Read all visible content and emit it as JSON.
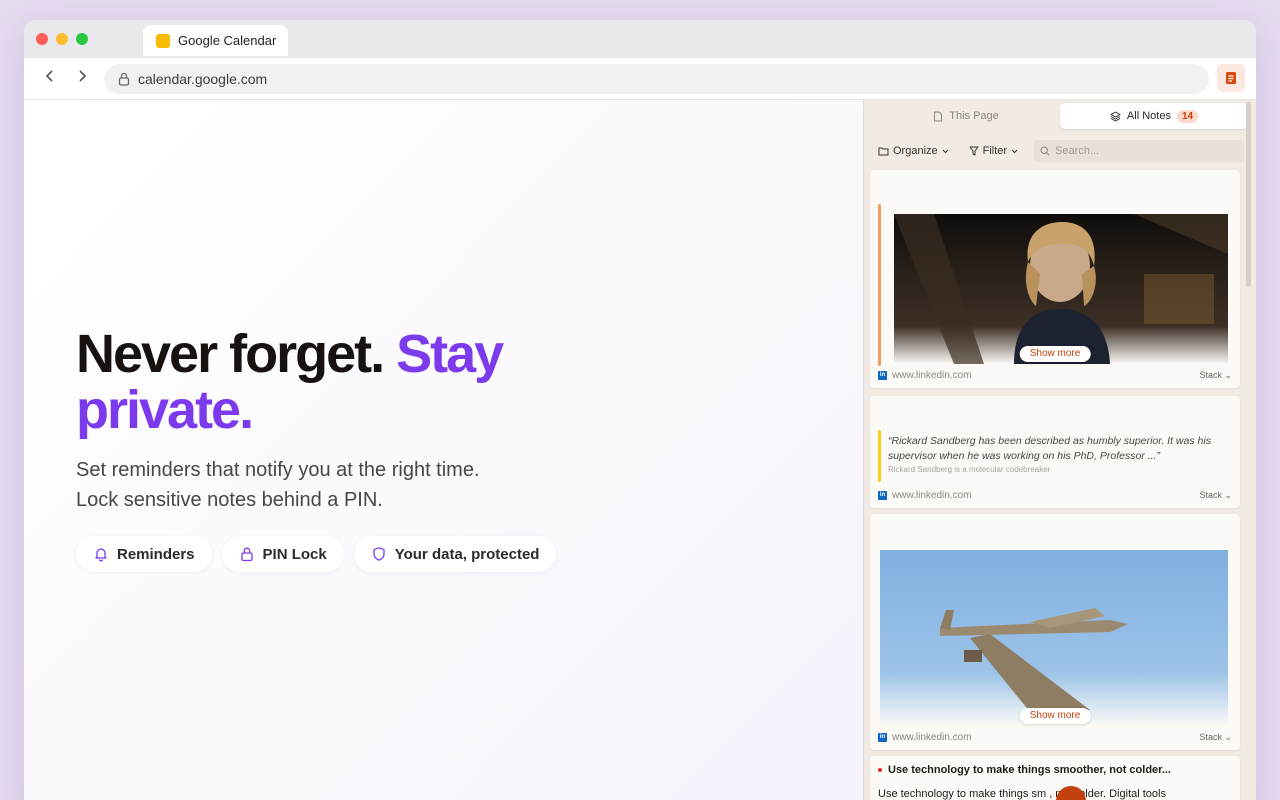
{
  "browser": {
    "tab_title": "Google Calendar",
    "url": "calendar.google.com"
  },
  "hero": {
    "headline_dark": "Never forget.",
    "headline_accent_1": "Stay",
    "headline_accent_2": "private.",
    "subtitle_line1": "Set reminders that notify you at the right time.",
    "subtitle_line2": "Lock sensitive notes behind a PIN.",
    "chips": [
      "Reminders",
      "PIN Lock",
      "Your data, protected"
    ],
    "accent_color": "#7c3aed"
  },
  "sidebar": {
    "tabs": [
      {
        "label": "This Page"
      },
      {
        "label": "All Notes",
        "count": "14"
      }
    ],
    "organize_label": "Organize",
    "filter_label": "Filter",
    "search_placeholder": "Search...",
    "cards": [
      {
        "show_more": "Show more",
        "source": "www.linkedin.com",
        "stack": "Stack"
      },
      {
        "quote": "“Rickard Sandberg has been described as humbly superior. It was his supervisor when he was working on his PhD, Professor ...”",
        "quote_sub": "Rickard Sandberg is a molecular codebreaker",
        "source": "www.linkedin.com",
        "stack": "Stack"
      },
      {
        "show_more": "Show more",
        "source": "www.linkedin.com",
        "stack": "Stack"
      },
      {
        "title": "Use technology to make things smoother, not colder...",
        "body": "Use technology to make things sm     , not colder. Digital tools"
      }
    ]
  }
}
